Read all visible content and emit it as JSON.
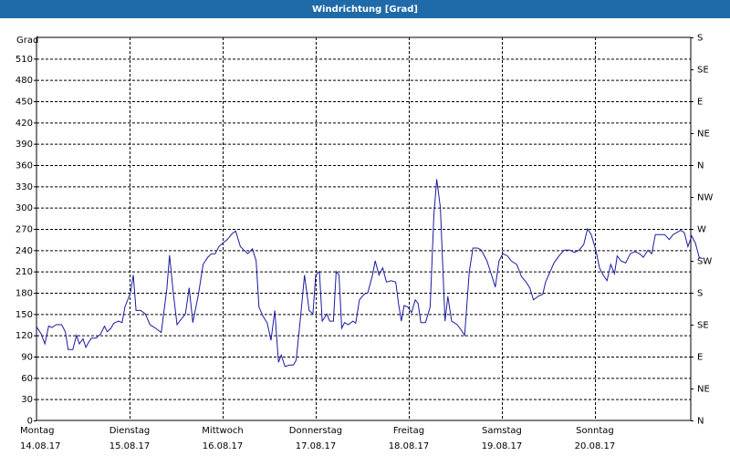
{
  "window": {
    "title": "Windrichtung [Grad]"
  },
  "colors": {
    "title_bar": "#1f6aa8",
    "series": "#1a1aa0",
    "grid": "#000000"
  },
  "chart_data": {
    "type": "line",
    "title": "Windrichtung [Grad]",
    "ylabel": "Grad",
    "ylim": [
      0,
      540
    ],
    "xlim_days": [
      0,
      7.03
    ],
    "grid": true,
    "y_ticks": [
      0,
      30,
      60,
      90,
      120,
      150,
      180,
      210,
      240,
      270,
      300,
      330,
      360,
      390,
      420,
      450,
      480,
      510
    ],
    "right_axis_labels": [
      "N",
      "NE",
      "E",
      "SE",
      "S",
      "SW",
      "W",
      "NW",
      "N",
      "NE",
      "E",
      "SE",
      "S"
    ],
    "x_labels": [
      {
        "day": "Montag",
        "date": "14.08.17"
      },
      {
        "day": "Dienstag",
        "date": "15.08.17"
      },
      {
        "day": "Mittwoch",
        "date": "16.08.17"
      },
      {
        "day": "Donnerstag",
        "date": "17.08.17"
      },
      {
        "day": "Freitag",
        "date": "18.08.17"
      },
      {
        "day": "Samstag",
        "date": "19.08.17"
      },
      {
        "day": "Sonntag",
        "date": "20.08.17"
      }
    ],
    "series": [
      {
        "values": [
          [
            0.0,
            132
          ],
          [
            0.05,
            122
          ],
          [
            0.09,
            108
          ],
          [
            0.13,
            133
          ],
          [
            0.17,
            131
          ],
          [
            0.21,
            135
          ],
          [
            0.27,
            135
          ],
          [
            0.31,
            125
          ],
          [
            0.34,
            100
          ],
          [
            0.39,
            100
          ],
          [
            0.43,
            120
          ],
          [
            0.46,
            108
          ],
          [
            0.5,
            115
          ],
          [
            0.53,
            103
          ],
          [
            0.56,
            110
          ],
          [
            0.59,
            116
          ],
          [
            0.64,
            116
          ],
          [
            0.69,
            122
          ],
          [
            0.73,
            133
          ],
          [
            0.76,
            125
          ],
          [
            0.8,
            130
          ],
          [
            0.83,
            137
          ],
          [
            0.88,
            140
          ],
          [
            0.92,
            138
          ],
          [
            0.95,
            160
          ],
          [
            1.01,
            180
          ],
          [
            1.04,
            205
          ],
          [
            1.07,
            155
          ],
          [
            1.12,
            155
          ],
          [
            1.17,
            150
          ],
          [
            1.22,
            135
          ],
          [
            1.28,
            130
          ],
          [
            1.34,
            124
          ],
          [
            1.4,
            185
          ],
          [
            1.43,
            233
          ],
          [
            1.47,
            180
          ],
          [
            1.51,
            135
          ],
          [
            1.55,
            142
          ],
          [
            1.6,
            150
          ],
          [
            1.64,
            187
          ],
          [
            1.68,
            138
          ],
          [
            1.74,
            178
          ],
          [
            1.79,
            220
          ],
          [
            1.84,
            230
          ],
          [
            1.88,
            235
          ],
          [
            1.92,
            235
          ],
          [
            1.96,
            245
          ],
          [
            2.0,
            250
          ],
          [
            2.05,
            255
          ],
          [
            2.1,
            263
          ],
          [
            2.14,
            267
          ],
          [
            2.19,
            245
          ],
          [
            2.23,
            240
          ],
          [
            2.27,
            235
          ],
          [
            2.32,
            242
          ],
          [
            2.36,
            225
          ],
          [
            2.39,
            160
          ],
          [
            2.43,
            148
          ],
          [
            2.48,
            137
          ],
          [
            2.52,
            113
          ],
          [
            2.56,
            155
          ],
          [
            2.6,
            82
          ],
          [
            2.63,
            92
          ],
          [
            2.67,
            76
          ],
          [
            2.72,
            78
          ],
          [
            2.76,
            78
          ],
          [
            2.79,
            85
          ],
          [
            2.84,
            150
          ],
          [
            2.88,
            205
          ],
          [
            2.93,
            155
          ],
          [
            2.97,
            150
          ],
          [
            3.0,
            205
          ],
          [
            3.04,
            210
          ],
          [
            3.07,
            140
          ],
          [
            3.12,
            150
          ],
          [
            3.15,
            140
          ],
          [
            3.19,
            140
          ],
          [
            3.22,
            210
          ],
          [
            3.25,
            205
          ],
          [
            3.28,
            130
          ],
          [
            3.31,
            138
          ],
          [
            3.35,
            135
          ],
          [
            3.4,
            140
          ],
          [
            3.43,
            137
          ],
          [
            3.47,
            170
          ],
          [
            3.52,
            178
          ],
          [
            3.56,
            180
          ],
          [
            3.61,
            205
          ],
          [
            3.64,
            225
          ],
          [
            3.68,
            205
          ],
          [
            3.72,
            215
          ],
          [
            3.76,
            195
          ],
          [
            3.81,
            197
          ],
          [
            3.86,
            195
          ],
          [
            3.89,
            165
          ],
          [
            3.92,
            140
          ],
          [
            3.95,
            162
          ],
          [
            3.99,
            160
          ],
          [
            4.03,
            152
          ],
          [
            4.07,
            170
          ],
          [
            4.1,
            165
          ],
          [
            4.13,
            138
          ],
          [
            4.18,
            138
          ],
          [
            4.23,
            160
          ],
          [
            4.27,
            290
          ],
          [
            4.3,
            340
          ],
          [
            4.34,
            300
          ],
          [
            4.39,
            140
          ],
          [
            4.42,
            175
          ],
          [
            4.46,
            140
          ],
          [
            4.52,
            135
          ],
          [
            4.56,
            128
          ],
          [
            4.6,
            120
          ],
          [
            4.65,
            210
          ],
          [
            4.69,
            243
          ],
          [
            4.74,
            243
          ],
          [
            4.78,
            240
          ],
          [
            4.84,
            225
          ],
          [
            4.89,
            205
          ],
          [
            4.93,
            188
          ],
          [
            4.97,
            225
          ],
          [
            5.01,
            235
          ],
          [
            5.06,
            232
          ],
          [
            5.1,
            225
          ],
          [
            5.16,
            220
          ],
          [
            5.21,
            203
          ],
          [
            5.26,
            195
          ],
          [
            5.3,
            187
          ],
          [
            5.34,
            170
          ],
          [
            5.39,
            175
          ],
          [
            5.44,
            178
          ],
          [
            5.47,
            195
          ],
          [
            5.52,
            210
          ],
          [
            5.56,
            222
          ],
          [
            5.62,
            233
          ],
          [
            5.67,
            240
          ],
          [
            5.73,
            240
          ],
          [
            5.78,
            237
          ],
          [
            5.83,
            240
          ],
          [
            5.88,
            248
          ],
          [
            5.92,
            270
          ],
          [
            5.96,
            262
          ],
          [
            6.01,
            240
          ],
          [
            6.05,
            215
          ],
          [
            6.09,
            205
          ],
          [
            6.13,
            197
          ],
          [
            6.17,
            220
          ],
          [
            6.21,
            207
          ],
          [
            6.24,
            232
          ],
          [
            6.28,
            225
          ],
          [
            6.33,
            222
          ],
          [
            6.38,
            235
          ],
          [
            6.43,
            238
          ],
          [
            6.48,
            235
          ],
          [
            6.52,
            230
          ],
          [
            6.57,
            240
          ],
          [
            6.61,
            235
          ],
          [
            6.65,
            262
          ],
          [
            6.7,
            262
          ],
          [
            6.75,
            262
          ],
          [
            6.8,
            255
          ],
          [
            6.84,
            262
          ],
          [
            6.88,
            265
          ],
          [
            6.92,
            268
          ],
          [
            6.96,
            265
          ],
          [
            7.0,
            245
          ],
          [
            7.04,
            260
          ],
          [
            7.08,
            250
          ],
          [
            7.12,
            230
          ],
          [
            7.16,
            228
          ]
        ]
      }
    ]
  }
}
